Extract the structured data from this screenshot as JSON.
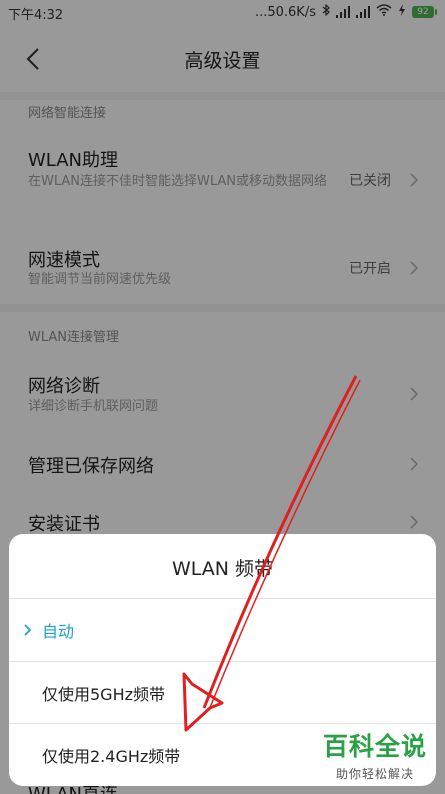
{
  "status_bar": {
    "time": "下午4:32",
    "net_speed": "...50.6K/s",
    "battery": "92"
  },
  "header": {
    "title": "高级设置"
  },
  "sections": [
    {
      "header": "网络智能连接",
      "rows": [
        {
          "title": "WLAN助理",
          "subtitle": "在WLAN连接不佳时智能选择WLAN或移动数据网络",
          "value": "已关闭"
        },
        {
          "title": "网速模式",
          "subtitle": "智能调节当前网速优先级",
          "value": "已开启"
        }
      ]
    },
    {
      "header": "WLAN连接管理",
      "rows": [
        {
          "title": "网络诊断",
          "subtitle": "详细诊断手机联网问题",
          "value": ""
        },
        {
          "title": "管理已保存网络",
          "subtitle": "",
          "value": ""
        },
        {
          "title": "安装证书",
          "subtitle": "",
          "value": ""
        },
        {
          "title": "WLAN直连",
          "subtitle": "",
          "value": ""
        }
      ]
    }
  ],
  "dialog": {
    "title": "WLAN  频带",
    "options": [
      {
        "label": "自动",
        "selected": true
      },
      {
        "label": "仅使用5GHz频带",
        "selected": false
      },
      {
        "label": "仅使用2.4GHz频带",
        "selected": false
      }
    ]
  },
  "watermark": {
    "main": "百科全说",
    "sub": "助你轻松解决"
  },
  "colors": {
    "accent": "#1e9fd6",
    "annotation_arrow": "#e02020",
    "watermark_green": "#2aa146",
    "battery_green": "#4caf50"
  },
  "icons": [
    "back-arrow-icon",
    "chevron-right-icon",
    "check-icon",
    "bluetooth-icon",
    "signal-icon",
    "wifi-icon",
    "battery-icon"
  ]
}
